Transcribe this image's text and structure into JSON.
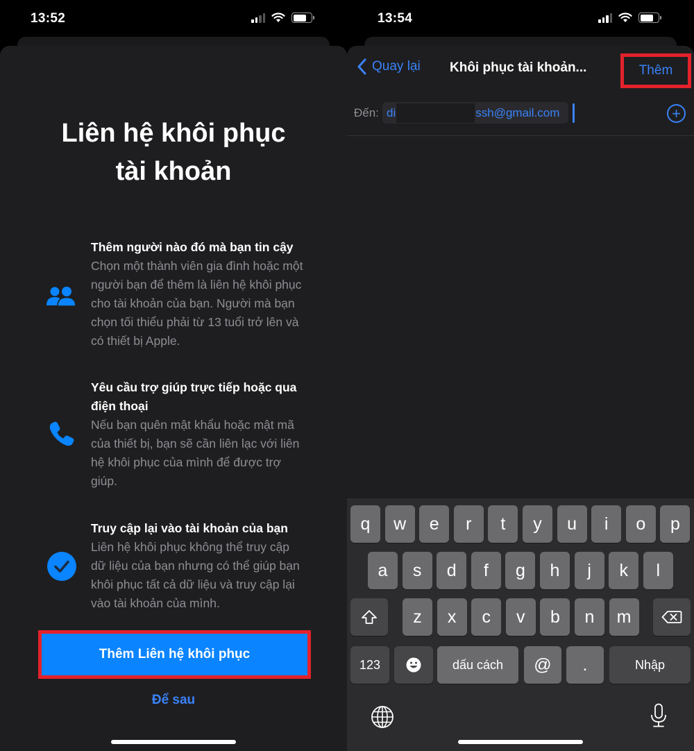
{
  "left_screen": {
    "status_bar": {
      "time": "13:52"
    },
    "title": "Liên hệ khôi phục tài khoản",
    "features": [
      {
        "icon": "people-icon",
        "heading": "Thêm người nào đó mà bạn tin cậy",
        "body": "Chọn một thành viên gia đình hoặc một người bạn để thêm là liên hệ khôi phục cho tài khoản của bạn. Người mà bạn chọn tối thiểu phải từ 13 tuổi trở lên và có thiết bị Apple."
      },
      {
        "icon": "phone-icon",
        "heading": "Yêu cầu trợ giúp trực tiếp hoặc qua điện thoại",
        "body": "Nếu bạn quên mật khẩu hoặc mật mã của thiết bị, bạn sẽ cần liên lạc với liên hệ khôi phục của mình để được trợ giúp."
      },
      {
        "icon": "checkmark-circle-icon",
        "heading": "Truy cập lại vào tài khoản của bạn",
        "body": "Liên hệ khôi phục không thể truy cập dữ liệu của bạn nhưng có thể giúp bạn khôi phục tất cả dữ liệu và truy cập lại vào tài khoản của mình."
      }
    ],
    "primary_button": "Thêm Liên hệ khôi phục",
    "secondary_link": "Để sau"
  },
  "right_screen": {
    "status_bar": {
      "time": "13:54"
    },
    "nav": {
      "back_label": "Quay lại",
      "title": "Khôi phục tài khoản...",
      "add_label": "Thêm"
    },
    "to_field": {
      "label": "Đến:",
      "value_prefix": "di",
      "value_suffix": "ssh@gmail.com"
    },
    "keyboard": {
      "row1": [
        "q",
        "w",
        "e",
        "r",
        "t",
        "y",
        "u",
        "i",
        "o",
        "p"
      ],
      "row2": [
        "a",
        "s",
        "d",
        "f",
        "g",
        "h",
        "j",
        "k",
        "l"
      ],
      "row3": [
        "z",
        "x",
        "c",
        "v",
        "b",
        "n",
        "m"
      ],
      "numbers_key": "123",
      "space_key": "dấu cách",
      "at_key": "@",
      "dot_key": ".",
      "return_key": "Nhập"
    }
  },
  "colors": {
    "accent_blue": "#0a84ff",
    "link_blue": "#3a82f7",
    "highlight_red": "#e3222b",
    "sheet_bg": "#1e1e20"
  }
}
